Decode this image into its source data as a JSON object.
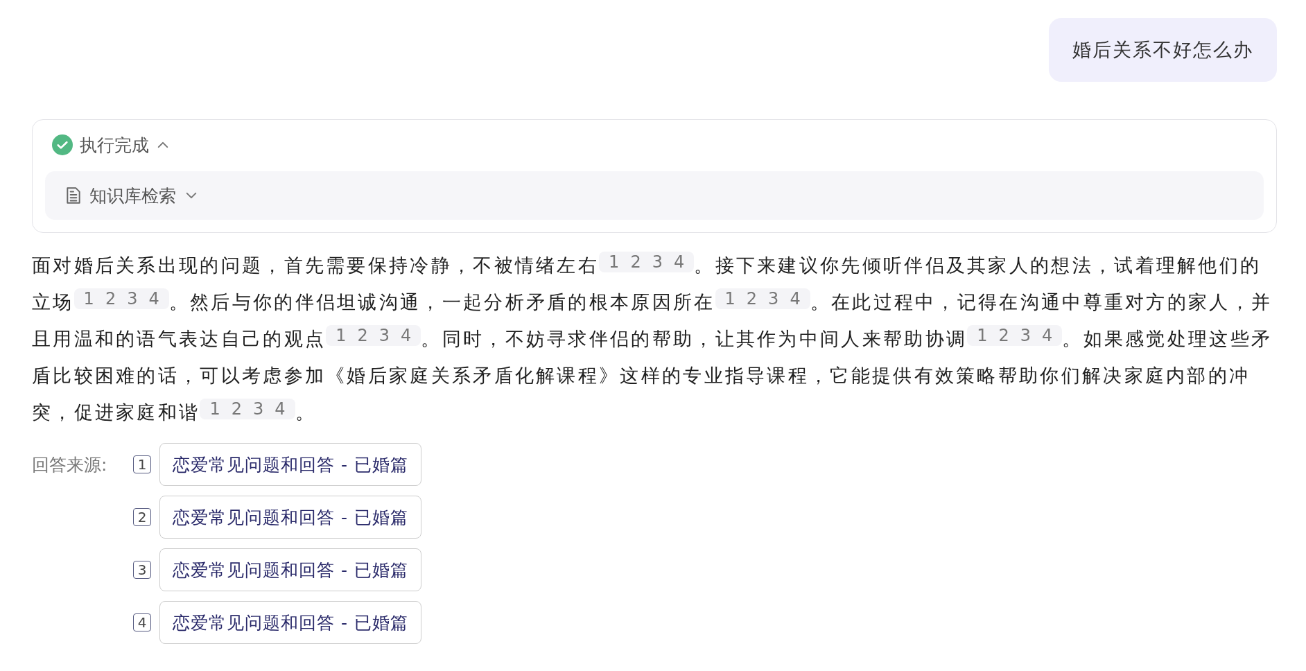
{
  "user_message": {
    "text": "婚后关系不好怎么办"
  },
  "process": {
    "status": "执行完成",
    "done": true,
    "expanded": true,
    "steps": [
      {
        "label": "知识库检索",
        "expanded": false
      }
    ]
  },
  "answer": {
    "segments": [
      {
        "text": "面对婚后关系出现的问题，首先需要保持冷静，不被情绪左右",
        "citations": [
          "1",
          "2",
          "3",
          "4"
        ]
      },
      {
        "text": "。接下来建议你先倾听伴侣及其家人的想法，试着理解他们的立场",
        "citations": [
          "1",
          "2",
          "3",
          "4"
        ]
      },
      {
        "text": "。然后与你的伴侣坦诚沟通，一起分析矛盾的根本原因所在",
        "citations": [
          "1",
          "2",
          "3",
          "4"
        ]
      },
      {
        "text": "。在此过程中，记得在沟通中尊重对方的家人，并且用温和的语气表达自己的观点",
        "citations": [
          "1",
          "2",
          "3",
          "4"
        ]
      },
      {
        "text": "。同时，不妨寻求伴侣的帮助，让其作为中间人来帮助协调",
        "citations": [
          "1",
          "2",
          "3",
          "4"
        ]
      },
      {
        "text": "。如果感觉处理这些矛盾比较困难的话，可以考虑参加《婚后家庭关系矛盾化解课程》这样的专业指导课程，它能提供有效策略帮助你们解决家庭内部的冲突，促进家庭和谐",
        "citations": [
          "1",
          "2",
          "3",
          "4"
        ]
      },
      {
        "text": "。"
      }
    ]
  },
  "sources": {
    "label": "回答来源:",
    "items": [
      {
        "index": "1",
        "title": "恋爱常见问题和回答 - 已婚篇"
      },
      {
        "index": "2",
        "title": "恋爱常见问题和回答 - 已婚篇"
      },
      {
        "index": "3",
        "title": "恋爱常见问题和回答 - 已婚篇"
      },
      {
        "index": "4",
        "title": "恋爱常见问题和回答 - 已婚篇"
      }
    ]
  }
}
